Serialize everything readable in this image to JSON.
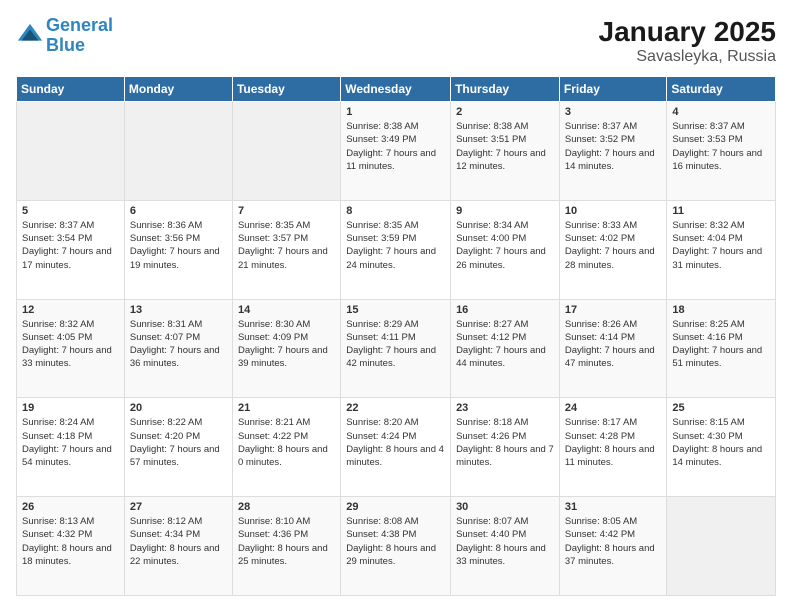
{
  "header": {
    "logo_line1": "General",
    "logo_line2": "Blue",
    "title": "January 2025",
    "subtitle": "Savasleyka, Russia"
  },
  "days_of_week": [
    "Sunday",
    "Monday",
    "Tuesday",
    "Wednesday",
    "Thursday",
    "Friday",
    "Saturday"
  ],
  "weeks": [
    [
      {
        "day": "",
        "info": ""
      },
      {
        "day": "",
        "info": ""
      },
      {
        "day": "",
        "info": ""
      },
      {
        "day": "1",
        "info": "Sunrise: 8:38 AM\nSunset: 3:49 PM\nDaylight: 7 hours and 11 minutes."
      },
      {
        "day": "2",
        "info": "Sunrise: 8:38 AM\nSunset: 3:51 PM\nDaylight: 7 hours and 12 minutes."
      },
      {
        "day": "3",
        "info": "Sunrise: 8:37 AM\nSunset: 3:52 PM\nDaylight: 7 hours and 14 minutes."
      },
      {
        "day": "4",
        "info": "Sunrise: 8:37 AM\nSunset: 3:53 PM\nDaylight: 7 hours and 16 minutes."
      }
    ],
    [
      {
        "day": "5",
        "info": "Sunrise: 8:37 AM\nSunset: 3:54 PM\nDaylight: 7 hours and 17 minutes."
      },
      {
        "day": "6",
        "info": "Sunrise: 8:36 AM\nSunset: 3:56 PM\nDaylight: 7 hours and 19 minutes."
      },
      {
        "day": "7",
        "info": "Sunrise: 8:35 AM\nSunset: 3:57 PM\nDaylight: 7 hours and 21 minutes."
      },
      {
        "day": "8",
        "info": "Sunrise: 8:35 AM\nSunset: 3:59 PM\nDaylight: 7 hours and 24 minutes."
      },
      {
        "day": "9",
        "info": "Sunrise: 8:34 AM\nSunset: 4:00 PM\nDaylight: 7 hours and 26 minutes."
      },
      {
        "day": "10",
        "info": "Sunrise: 8:33 AM\nSunset: 4:02 PM\nDaylight: 7 hours and 28 minutes."
      },
      {
        "day": "11",
        "info": "Sunrise: 8:32 AM\nSunset: 4:04 PM\nDaylight: 7 hours and 31 minutes."
      }
    ],
    [
      {
        "day": "12",
        "info": "Sunrise: 8:32 AM\nSunset: 4:05 PM\nDaylight: 7 hours and 33 minutes."
      },
      {
        "day": "13",
        "info": "Sunrise: 8:31 AM\nSunset: 4:07 PM\nDaylight: 7 hours and 36 minutes."
      },
      {
        "day": "14",
        "info": "Sunrise: 8:30 AM\nSunset: 4:09 PM\nDaylight: 7 hours and 39 minutes."
      },
      {
        "day": "15",
        "info": "Sunrise: 8:29 AM\nSunset: 4:11 PM\nDaylight: 7 hours and 42 minutes."
      },
      {
        "day": "16",
        "info": "Sunrise: 8:27 AM\nSunset: 4:12 PM\nDaylight: 7 hours and 44 minutes."
      },
      {
        "day": "17",
        "info": "Sunrise: 8:26 AM\nSunset: 4:14 PM\nDaylight: 7 hours and 47 minutes."
      },
      {
        "day": "18",
        "info": "Sunrise: 8:25 AM\nSunset: 4:16 PM\nDaylight: 7 hours and 51 minutes."
      }
    ],
    [
      {
        "day": "19",
        "info": "Sunrise: 8:24 AM\nSunset: 4:18 PM\nDaylight: 7 hours and 54 minutes."
      },
      {
        "day": "20",
        "info": "Sunrise: 8:22 AM\nSunset: 4:20 PM\nDaylight: 7 hours and 57 minutes."
      },
      {
        "day": "21",
        "info": "Sunrise: 8:21 AM\nSunset: 4:22 PM\nDaylight: 8 hours and 0 minutes."
      },
      {
        "day": "22",
        "info": "Sunrise: 8:20 AM\nSunset: 4:24 PM\nDaylight: 8 hours and 4 minutes."
      },
      {
        "day": "23",
        "info": "Sunrise: 8:18 AM\nSunset: 4:26 PM\nDaylight: 8 hours and 7 minutes."
      },
      {
        "day": "24",
        "info": "Sunrise: 8:17 AM\nSunset: 4:28 PM\nDaylight: 8 hours and 11 minutes."
      },
      {
        "day": "25",
        "info": "Sunrise: 8:15 AM\nSunset: 4:30 PM\nDaylight: 8 hours and 14 minutes."
      }
    ],
    [
      {
        "day": "26",
        "info": "Sunrise: 8:13 AM\nSunset: 4:32 PM\nDaylight: 8 hours and 18 minutes."
      },
      {
        "day": "27",
        "info": "Sunrise: 8:12 AM\nSunset: 4:34 PM\nDaylight: 8 hours and 22 minutes."
      },
      {
        "day": "28",
        "info": "Sunrise: 8:10 AM\nSunset: 4:36 PM\nDaylight: 8 hours and 25 minutes."
      },
      {
        "day": "29",
        "info": "Sunrise: 8:08 AM\nSunset: 4:38 PM\nDaylight: 8 hours and 29 minutes."
      },
      {
        "day": "30",
        "info": "Sunrise: 8:07 AM\nSunset: 4:40 PM\nDaylight: 8 hours and 33 minutes."
      },
      {
        "day": "31",
        "info": "Sunrise: 8:05 AM\nSunset: 4:42 PM\nDaylight: 8 hours and 37 minutes."
      },
      {
        "day": "",
        "info": ""
      }
    ]
  ]
}
